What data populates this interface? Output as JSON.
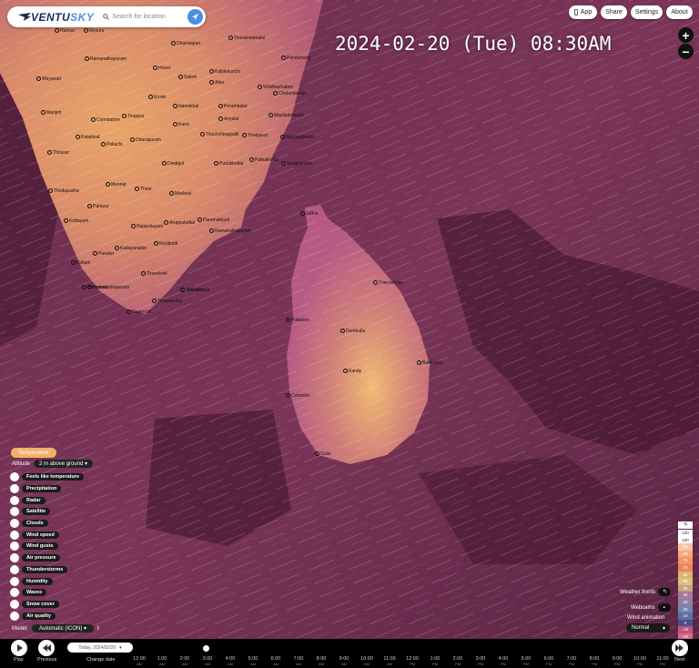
{
  "app": {
    "logo_text": "VENTU",
    "logo_text_accent": "SKY",
    "search_placeholder": "Search for location"
  },
  "top_buttons": {
    "app": "App",
    "share": "Share",
    "settings": "Settings",
    "about": "About"
  },
  "datetime": "2024-02-20 (Tue) 08:30AM",
  "zoom": {
    "in": "+",
    "out": "−"
  },
  "layer_panel": {
    "active_layer": "Temperature",
    "altitude_label": "Altitude",
    "altitude_value": "2 m above ground",
    "items": [
      {
        "label": "Feels like temperature",
        "icon": "thermometer-icon"
      },
      {
        "label": "Precipitation",
        "icon": "rain-icon"
      },
      {
        "label": "Radar",
        "icon": "radar-icon"
      },
      {
        "label": "Satellite",
        "icon": "satellite-icon"
      },
      {
        "label": "Clouds",
        "icon": "cloud-icon"
      },
      {
        "label": "Wind speed",
        "icon": "wind-icon"
      },
      {
        "label": "Wind gusts",
        "icon": "gust-icon"
      },
      {
        "label": "Air pressure",
        "icon": "pressure-icon"
      },
      {
        "label": "Thunderstorms",
        "icon": "lightning-icon"
      },
      {
        "label": "Humidity",
        "icon": "humidity-icon"
      },
      {
        "label": "Waves",
        "icon": "wave-icon"
      },
      {
        "label": "Snow cover",
        "icon": "snow-icon"
      },
      {
        "label": "Air quality",
        "icon": "air-quality-icon"
      }
    ],
    "model_label": "Model:",
    "model_value": "Automatic (ICON)",
    "model_info": "i"
  },
  "right_controls": {
    "weather_fronts": "Weather fronts",
    "webcams": "Webcams",
    "wind_animation": "Wind animation",
    "animation_value": "Normal"
  },
  "legend": {
    "unit": "°F",
    "values": [
      "120",
      "100",
      "90",
      "80",
      "75",
      "70",
      "65",
      "60",
      "50",
      "40",
      "30",
      "20",
      "10",
      "0",
      "-10",
      "-20",
      "-40"
    ],
    "colors": [
      "#fff",
      "#fff",
      "#f5c6a0",
      "#f4a97a",
      "#f2955e",
      "#e9855e",
      "#e2b070",
      "#d9c27a",
      "#c7a37e",
      "#a77a9a",
      "#8d7ea2",
      "#7088b0",
      "#5f6ea3",
      "#4a4f89",
      "#c0577a",
      "#d46b8e",
      "#e28aa4"
    ]
  },
  "timeline": {
    "play_label": "Play",
    "previous_label": "Previous",
    "next_label": "Next",
    "day_picker": "Today, 2024/02/20",
    "change_date": "Change date",
    "times": [
      {
        "t": "12:00",
        "s": "AM"
      },
      {
        "t": "1:00",
        "s": "AM"
      },
      {
        "t": "2:00",
        "s": "AM"
      },
      {
        "t": "3:00",
        "s": "AM"
      },
      {
        "t": "4:00",
        "s": "AM"
      },
      {
        "t": "5:00",
        "s": "AM"
      },
      {
        "t": "6:00",
        "s": "AM"
      },
      {
        "t": "7:00",
        "s": "AM"
      },
      {
        "t": "8:00",
        "s": "AM"
      },
      {
        "t": "9:00",
        "s": "AM"
      },
      {
        "t": "10:00",
        "s": "AM"
      },
      {
        "t": "11:00",
        "s": "AM"
      },
      {
        "t": "12:00",
        "s": "PM"
      },
      {
        "t": "1:00",
        "s": "PM"
      },
      {
        "t": "2:00",
        "s": "PM"
      },
      {
        "t": "3:00",
        "s": "PM"
      },
      {
        "t": "4:00",
        "s": "PM"
      },
      {
        "t": "5:00",
        "s": "PM"
      },
      {
        "t": "6:00",
        "s": "PM"
      },
      {
        "t": "7:00",
        "s": "PM"
      },
      {
        "t": "8:00",
        "s": "PM"
      },
      {
        "t": "9:00",
        "s": "PM"
      },
      {
        "t": "10:00",
        "s": "PM"
      },
      {
        "t": "11:00",
        "s": "PM"
      }
    ]
  },
  "cities": [
    {
      "name": "Hunsur"
    },
    {
      "name": "Mysuru"
    },
    {
      "name": "Dharmapuri"
    },
    {
      "name": "Tiruvannamalai"
    },
    {
      "name": "Ramanathapuram"
    },
    {
      "name": "Hosur"
    },
    {
      "name": "Salem"
    },
    {
      "name": "Kallakkurichi"
    },
    {
      "name": "Pondicherry"
    },
    {
      "name": "Wayanad"
    },
    {
      "name": "Erode"
    },
    {
      "name": "Attur"
    },
    {
      "name": "Vriddhachalam"
    },
    {
      "name": "Chidambaram"
    },
    {
      "name": "Manjeri"
    },
    {
      "name": "Namakkal"
    },
    {
      "name": "Perambalur"
    },
    {
      "name": "Mayiladuthurai"
    },
    {
      "name": "Coimbatore"
    },
    {
      "name": "Tiruppur"
    },
    {
      "name": "Karur"
    },
    {
      "name": "Ariyalur"
    },
    {
      "name": "Thanjavur"
    },
    {
      "name": "Palakkad"
    },
    {
      "name": "Pollachi"
    },
    {
      "name": "Dharapuram"
    },
    {
      "name": "Tiruchchirappalli"
    },
    {
      "name": "Nagapattinam"
    },
    {
      "name": "Thrissur"
    },
    {
      "name": "Dindigul"
    },
    {
      "name": "Pudukkottai"
    },
    {
      "name": "Pattukkottai"
    },
    {
      "name": "Vedaranyam"
    },
    {
      "name": "Munnar"
    },
    {
      "name": "Theni"
    },
    {
      "name": "Thodupuzha"
    },
    {
      "name": "Madurai"
    },
    {
      "name": "Kottayam"
    },
    {
      "name": "Paravur"
    },
    {
      "name": "Aruppukottai"
    },
    {
      "name": "Paramakkudi"
    },
    {
      "name": "Ramanathapuram"
    },
    {
      "name": "Kollam"
    },
    {
      "name": "Rajapalayam"
    },
    {
      "name": "Kovilpatti"
    },
    {
      "name": "Punalur"
    },
    {
      "name": "Kadayanallur"
    },
    {
      "name": "Tirunelveli"
    },
    {
      "name": "Varkala"
    },
    {
      "name": "Tuticorin"
    },
    {
      "name": "Thiruvananthapuram"
    },
    {
      "name": "Tiruchendur"
    },
    {
      "name": "Tisaiyanvilai"
    },
    {
      "name": "Nagercoil"
    },
    {
      "name": "Jaffna"
    },
    {
      "name": "Trincomalee"
    },
    {
      "name": "Puttalam"
    },
    {
      "name": "Dambulla"
    },
    {
      "name": "Kandy"
    },
    {
      "name": "Batticaloa"
    },
    {
      "name": "Colombo"
    },
    {
      "name": "Galle"
    }
  ]
}
